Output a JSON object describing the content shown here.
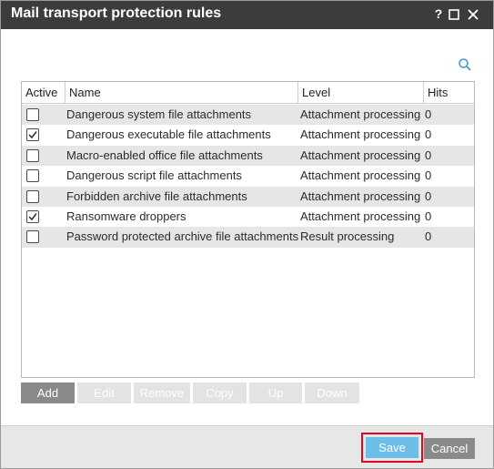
{
  "window": {
    "title": "Mail transport protection rules",
    "help_glyph": "?",
    "icons": {
      "help": "help-icon",
      "maximize": "maximize-icon",
      "close": "close-icon",
      "search": "search-icon"
    }
  },
  "table": {
    "headers": {
      "active": "Active",
      "name": "Name",
      "level": "Level",
      "hits": "Hits"
    },
    "rows": [
      {
        "active": false,
        "name": "Dangerous system file attachments",
        "level": "Attachment processing",
        "hits": "0"
      },
      {
        "active": true,
        "name": "Dangerous executable file attachments",
        "level": "Attachment processing",
        "hits": "0"
      },
      {
        "active": false,
        "name": "Macro-enabled office file attachments",
        "level": "Attachment processing",
        "hits": "0"
      },
      {
        "active": false,
        "name": "Dangerous script file attachments",
        "level": "Attachment processing",
        "hits": "0"
      },
      {
        "active": false,
        "name": "Forbidden archive file attachments",
        "level": "Attachment processing",
        "hits": "0"
      },
      {
        "active": true,
        "name": "Ransomware droppers",
        "level": "Attachment processing",
        "hits": "0"
      },
      {
        "active": false,
        "name": "Password protected archive file attachments",
        "level": "Result processing",
        "hits": "0"
      }
    ]
  },
  "toolbar": {
    "add": "Add",
    "edit": "Edit",
    "remove": "Remove",
    "copy": "Copy",
    "up": "Up",
    "down": "Down"
  },
  "footer": {
    "save": "Save",
    "cancel": "Cancel"
  },
  "colors": {
    "titlebar": "#3c3c3c",
    "accent_blue": "#6cbde8",
    "highlight_red": "#e0061e",
    "button_gray": "#8a8a8a",
    "row_alt": "#e6e6e6"
  }
}
